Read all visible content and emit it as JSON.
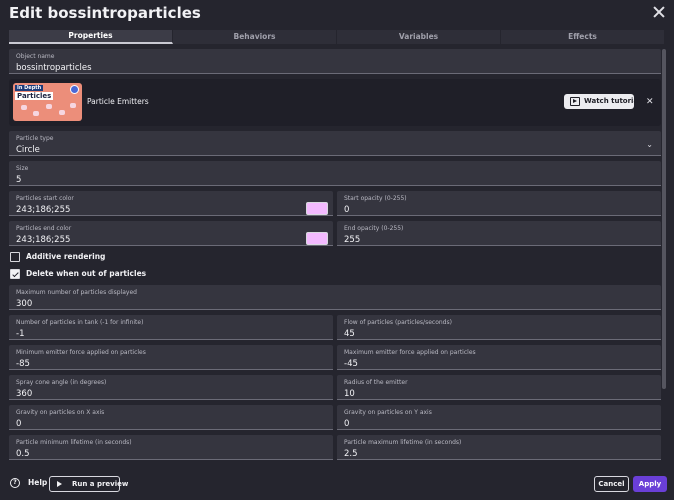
{
  "window": {
    "title": "Edit bossintroparticles"
  },
  "tabs": [
    {
      "label": "Properties",
      "active": true
    },
    {
      "label": "Behaviors",
      "active": false
    },
    {
      "label": "Variables",
      "active": false
    },
    {
      "label": "Effects",
      "active": false
    }
  ],
  "object_name": {
    "label": "Object name",
    "value": "bossintroparticles"
  },
  "tutorial": {
    "thumb_tag": "In Depth",
    "thumb_title": "Particles",
    "label": "Particle Emitters",
    "watch_label": "Watch tutorial"
  },
  "particle_type": {
    "label": "Particle type",
    "value": "Circle"
  },
  "size": {
    "label": "Size",
    "value": "5"
  },
  "start_color": {
    "label": "Particles start color",
    "value": "243;186;255",
    "swatch": "#f3baff"
  },
  "start_opacity": {
    "label": "Start opacity (0-255)",
    "value": "0"
  },
  "end_color": {
    "label": "Particles end color",
    "value": "243;186;255",
    "swatch": "#f3baff"
  },
  "end_opacity": {
    "label": "End opacity (0-255)",
    "value": "255"
  },
  "additive_rendering": {
    "label": "Additive rendering",
    "checked": false
  },
  "delete_when_out": {
    "label": "Delete when out of particles",
    "checked": true
  },
  "max_particles": {
    "label": "Maximum number of particles displayed",
    "value": "300"
  },
  "tank": {
    "label": "Number of particles in tank (-1 for infinite)",
    "value": "-1"
  },
  "flow": {
    "label": "Flow of particles (particles/seconds)",
    "value": "45"
  },
  "min_force": {
    "label": "Minimum emitter force applied on particles",
    "value": "-85"
  },
  "max_force": {
    "label": "Maximum emitter force applied on particles",
    "value": "-45"
  },
  "spray_angle": {
    "label": "Spray cone angle (in degrees)",
    "value": "360"
  },
  "radius": {
    "label": "Radius of the emitter",
    "value": "10"
  },
  "gravity_x": {
    "label": "Gravity on particles on X axis",
    "value": "0"
  },
  "gravity_y": {
    "label": "Gravity on particles on Y axis",
    "value": "0"
  },
  "min_lifetime": {
    "label": "Particle minimum lifetime (in seconds)",
    "value": "0.5"
  },
  "max_lifetime": {
    "label": "Particle maximum lifetime (in seconds)",
    "value": "2.5"
  },
  "footer": {
    "help_label": "Help",
    "preview_label": "Run a preview",
    "cancel_label": "Cancel",
    "apply_label": "Apply"
  },
  "colors": {
    "accent": "#6a3fd7",
    "background": "#25252e",
    "field": "#35353f"
  },
  "icons": [
    "close-icon",
    "chevron-down-icon",
    "play-icon",
    "help-icon",
    "checkbox-icon"
  ]
}
